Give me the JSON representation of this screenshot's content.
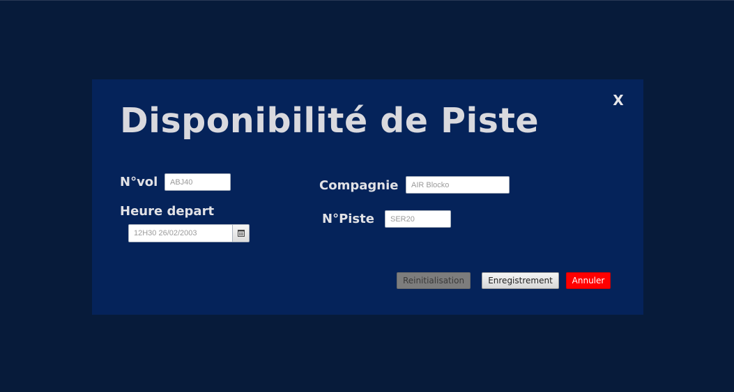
{
  "dialog": {
    "title": "Disponibilité de Piste",
    "close_label": "X"
  },
  "form": {
    "vol_label": "N°vol",
    "vol_value": "ABJ40",
    "heure_label": "Heure depart",
    "heure_value": "12H30 26/02/2003",
    "compagnie_label": "Compagnie",
    "compagnie_value": "AIR Blocko",
    "piste_label": "N°Piste",
    "piste_value": "SER20"
  },
  "buttons": {
    "reset_label": "Reinitialisation",
    "save_label": "Enregistrement",
    "cancel_label": "Annuler"
  },
  "colors": {
    "page_background": "#071b3a",
    "dialog_background": "#05235a",
    "cancel_button": "#ff0000",
    "reset_button": "#7d7d7d"
  },
  "icons": {
    "close": "close-icon",
    "calendar": "calendar-icon"
  }
}
